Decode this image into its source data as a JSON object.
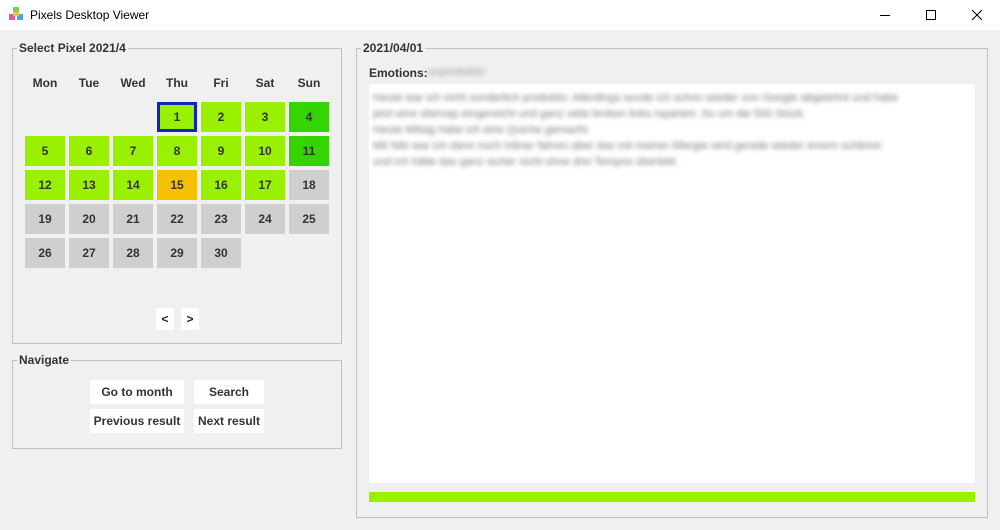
{
  "window": {
    "title": "Pixels Desktop Viewer",
    "controls": {
      "minimize": "—",
      "maximize": "☐",
      "close": "✕"
    }
  },
  "calendar": {
    "legend": "Select Pixel 2021/4",
    "weekdays": [
      "Mon",
      "Tue",
      "Wed",
      "Thu",
      "Fri",
      "Sat",
      "Sun"
    ],
    "days": [
      {
        "label": "1",
        "color": "#99f000",
        "selected": true
      },
      {
        "label": "2",
        "color": "#99f000"
      },
      {
        "label": "3",
        "color": "#99f000"
      },
      {
        "label": "4",
        "color": "#33d400"
      },
      {
        "label": "5",
        "color": "#99f000"
      },
      {
        "label": "6",
        "color": "#99f000"
      },
      {
        "label": "7",
        "color": "#99f000"
      },
      {
        "label": "8",
        "color": "#99f000"
      },
      {
        "label": "9",
        "color": "#99f000"
      },
      {
        "label": "10",
        "color": "#99f000"
      },
      {
        "label": "11",
        "color": "#33d400"
      },
      {
        "label": "12",
        "color": "#99f000"
      },
      {
        "label": "13",
        "color": "#99f000"
      },
      {
        "label": "14",
        "color": "#99f000"
      },
      {
        "label": "15",
        "color": "#f5c000"
      },
      {
        "label": "16",
        "color": "#99f000"
      },
      {
        "label": "17",
        "color": "#99f000"
      },
      {
        "label": "18",
        "color": "#cfcfcf"
      },
      {
        "label": "19",
        "color": "#cfcfcf"
      },
      {
        "label": "20",
        "color": "#cfcfcf"
      },
      {
        "label": "21",
        "color": "#cfcfcf"
      },
      {
        "label": "22",
        "color": "#cfcfcf"
      },
      {
        "label": "23",
        "color": "#cfcfcf"
      },
      {
        "label": "24",
        "color": "#cfcfcf"
      },
      {
        "label": "25",
        "color": "#cfcfcf"
      },
      {
        "label": "26",
        "color": "#cfcfcf"
      },
      {
        "label": "27",
        "color": "#cfcfcf"
      },
      {
        "label": "28",
        "color": "#cfcfcf"
      },
      {
        "label": "29",
        "color": "#cfcfcf"
      },
      {
        "label": "30",
        "color": "#cfcfcf"
      }
    ],
    "prev_label": "<",
    "next_label": ">"
  },
  "navigate": {
    "legend": "Navigate",
    "go_to_month": "Go to month",
    "search": "Search",
    "previous_result": "Previous result",
    "next_result": "Next result"
  },
  "detail": {
    "legend": "2021/04/01",
    "emotions_label": "Emotions:",
    "emotions_value": "unproduktiv",
    "notes": "Heute war ich nicht sonderlich produktiv. Allerdings wurde ich schon wieder von Google abgelehnt und habe\njetzt eine sitemap eingereicht und ganz viele broken links repariert. So um die 500 Stück.\nHeute Mittag habe ich eine Quiche gemacht.\nMit Nils war ich dann noch Inliner fahren aber das mit meiner Allergie wird gerade wieder enorm schlimm\nund ich hätte das ganz sicher nicht ohne drei Tempos überlebt.",
    "mood_color": "#99f000"
  }
}
